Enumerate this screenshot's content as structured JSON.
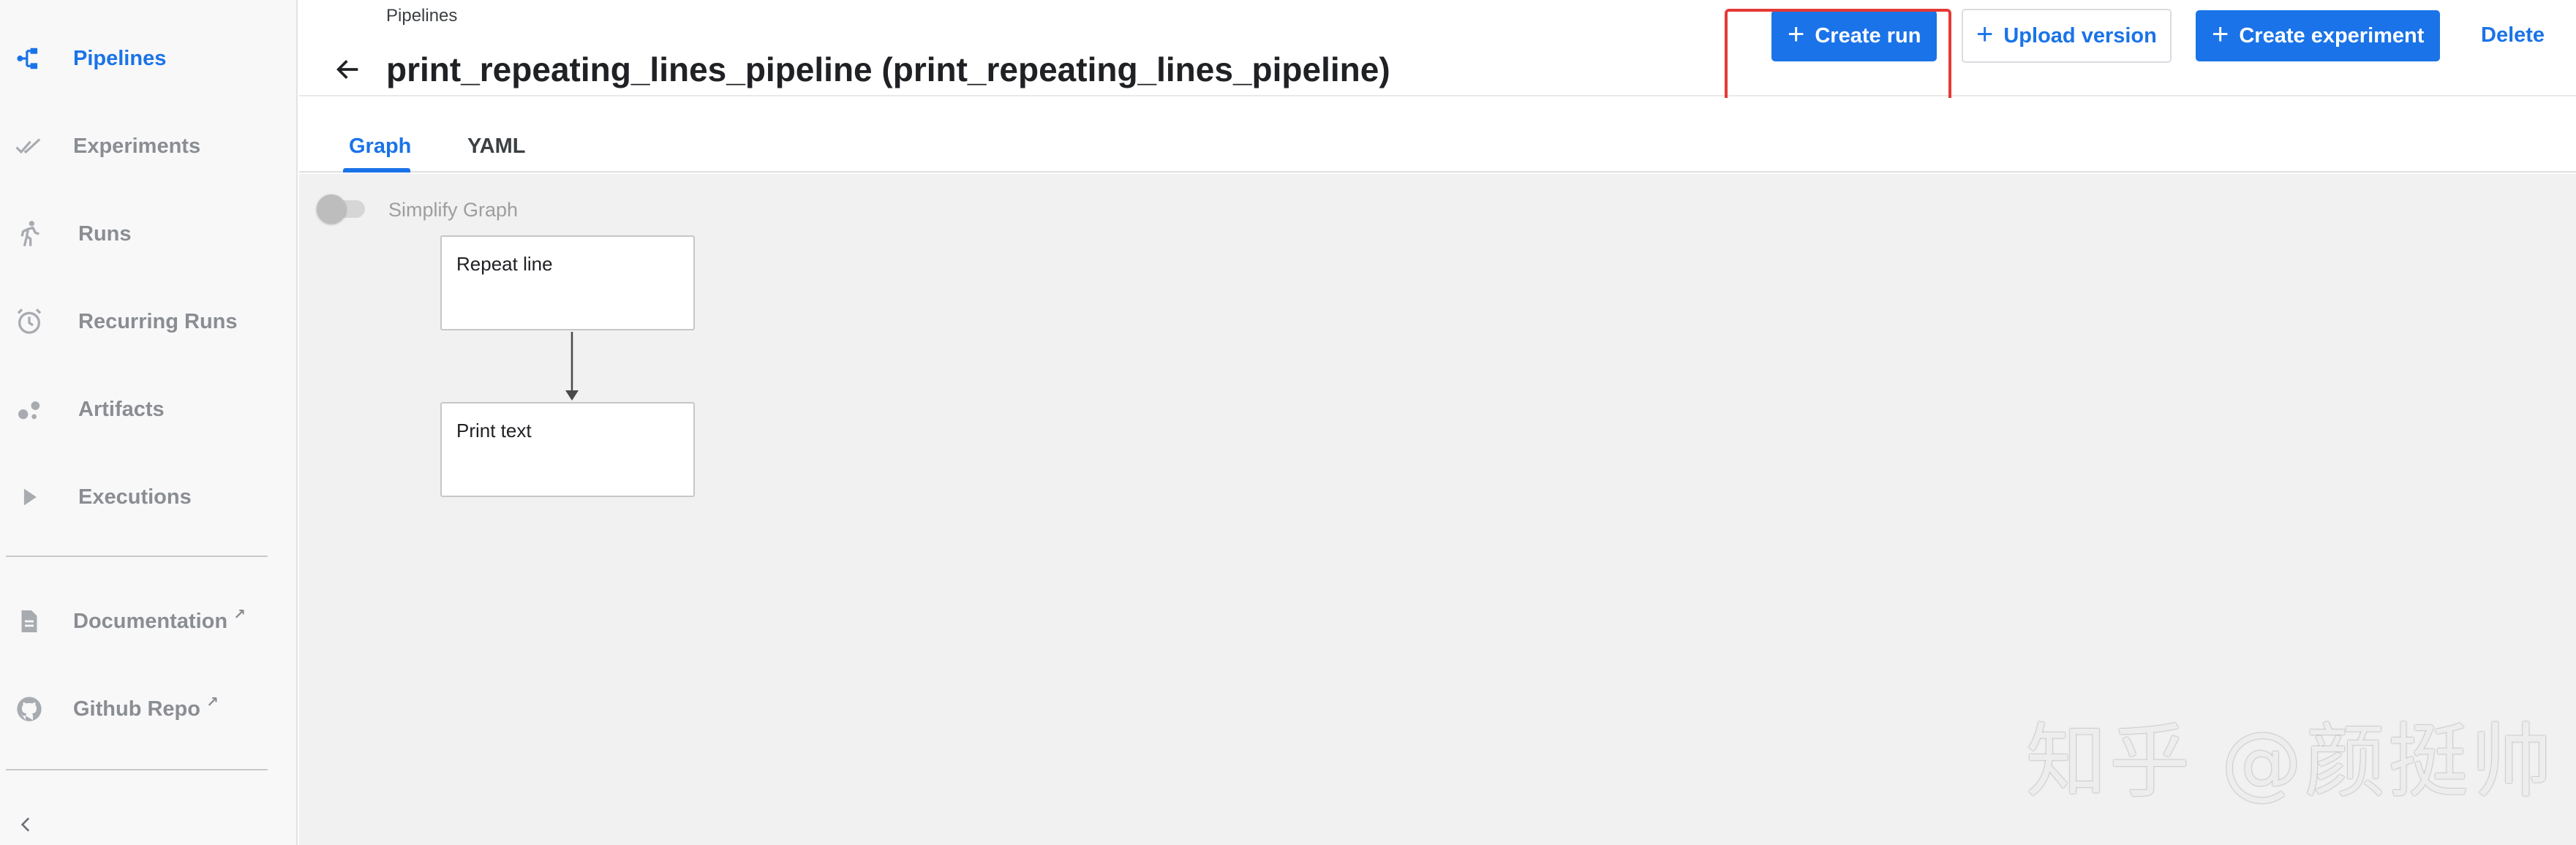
{
  "sidebar": {
    "items": [
      {
        "label": "Pipelines",
        "icon": "pipelines-icon",
        "active": true
      },
      {
        "label": "Experiments",
        "icon": "experiments-icon",
        "active": false
      },
      {
        "label": "Runs",
        "icon": "runs-icon",
        "active": false
      },
      {
        "label": "Recurring Runs",
        "icon": "alarm-clock-icon",
        "active": false
      },
      {
        "label": "Artifacts",
        "icon": "artifacts-icon",
        "active": false
      },
      {
        "label": "Executions",
        "icon": "play-icon",
        "active": false
      }
    ],
    "links": [
      {
        "label": "Documentation",
        "icon": "document-icon",
        "external": true
      },
      {
        "label": "Github Repo",
        "icon": "github-icon",
        "external": true
      }
    ],
    "collapse_icon": "chevron-left-icon"
  },
  "header": {
    "breadcrumb": "Pipelines",
    "title": "print_repeating_lines_pipeline (print_repeating_lines_pipeline)",
    "actions": {
      "create_run": "Create run",
      "upload_version": "Upload version",
      "create_experiment": "Create experiment",
      "delete": "Delete"
    }
  },
  "tabs": {
    "graph": "Graph",
    "yaml": "YAML",
    "active": "Graph"
  },
  "canvas": {
    "simplify_label": "Simplify Graph",
    "simplify_enabled": false,
    "nodes": [
      {
        "label": "Repeat line"
      },
      {
        "label": "Print text"
      }
    ]
  },
  "watermark": "知乎 @颜挺帅",
  "colors": {
    "accent": "#1a73e8",
    "highlight": "#e53935",
    "canvas_bg": "#f1f1f1",
    "sidebar_bg": "#f8f8f9"
  }
}
